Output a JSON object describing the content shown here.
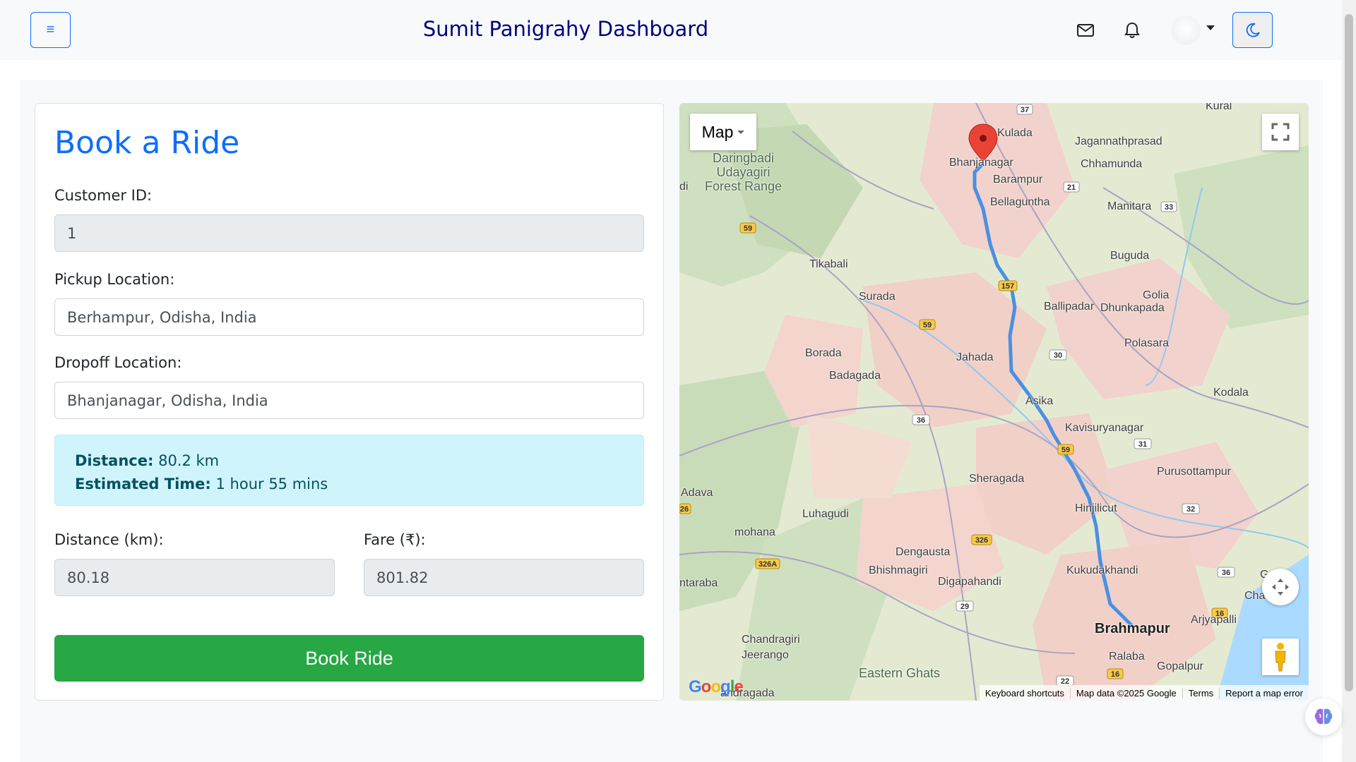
{
  "header": {
    "menu_label": "≡",
    "title": "Sumit Panigrahy Dashboard",
    "icons": [
      "mail-icon",
      "bell-icon",
      "avatar",
      "moon-icon"
    ]
  },
  "form": {
    "title": "Book a Ride",
    "customer_id_label": "Customer ID:",
    "customer_id_value": "1",
    "pickup_label": "Pickup Location:",
    "pickup_value": "Berhampur, Odisha, India",
    "dropoff_label": "Dropoff Location:",
    "dropoff_value": "Bhanjanagar, Odisha, India",
    "info": {
      "distance_label": "Distance:",
      "distance_value": "80.2 km",
      "time_label": "Estimated Time:",
      "time_value": "1 hour 55 mins"
    },
    "distance_km_label": "Distance (km):",
    "distance_km_value": "80.18",
    "fare_label": "Fare (₹):",
    "fare_value": "801.82",
    "book_button": "Book Ride"
  },
  "map": {
    "type_label": "Map",
    "places": {
      "kural": "Kural",
      "kulada": "Kulada",
      "jagannathprasad": "Jagannathprasad",
      "bhanjanagar": "Bhanjanagar",
      "chhamunda": "Chhamunda",
      "barampur": "Barampur",
      "bellaguntha": "Bellaguntha",
      "manitara": "Manitara",
      "daringbadi": "Daringbadi\nUdayagiri\nForest Range",
      "buguda": "Buguda",
      "tikabali": "Tikabali",
      "golia": "Golia",
      "suruda": "Surada",
      "ballipadar": "Ballipadar",
      "dhunkapada": "Dhunkapada",
      "polasara": "Polasara",
      "borada": "Borada",
      "jahada": "Jahada",
      "badagada": "Badagada",
      "kodala": "Kodala",
      "asika": "Asika",
      "kavisuryanagar": "Kavisuryanagar",
      "sheragada": "Sheragada",
      "purusottampur": "Purusottampur",
      "adava": "Adava",
      "hinjilicut": "Hinjilicut",
      "luhagudi": "Luhagudi",
      "mohana": "mohana",
      "dengausta": "Dengausta",
      "bhishmagiri": "Bhishmagiri",
      "kukudakhandi": "Kukudakhandi",
      "digapahandi": "Digapahandi",
      "ntaraba": "ntaraba",
      "brahmapur": "Brahmapur",
      "arjyapalli": "Arjyapalli",
      "chandragiri": "Chandragiri",
      "jeerango": "Jeerango",
      "ralaba": "Ralaba",
      "gopalpur": "Gopalpur",
      "eastern_ghats": "Eastern Ghats",
      "gandragada": "andragada",
      "ga": "Ga",
      "cha": "Cha",
      "di": "di"
    },
    "highways": [
      "37",
      "21",
      "33",
      "59",
      "157",
      "59",
      "30",
      "36",
      "59",
      "31",
      "32",
      "326",
      "326A",
      "29",
      "36",
      "16",
      "22",
      "16",
      "26"
    ],
    "footer": {
      "shortcuts": "Keyboard shortcuts",
      "data": "Map data ©2025 Google",
      "terms": "Terms",
      "report": "Report a map error"
    },
    "logo": "Google"
  },
  "colors": {
    "primary": "#0d6efd",
    "success": "#28a745",
    "info_bg": "#cff4fc",
    "header_title": "#000080",
    "route": "#4a90e2"
  }
}
